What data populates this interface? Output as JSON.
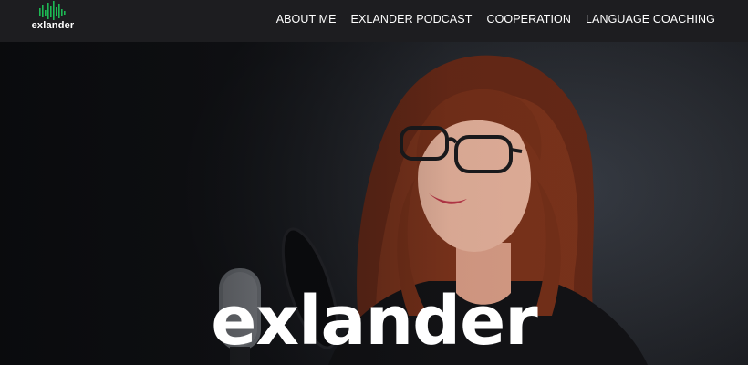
{
  "header": {
    "logo_text": "exlander",
    "nav": [
      {
        "label": "ABOUT ME"
      },
      {
        "label": "EXLANDER PODCAST"
      },
      {
        "label": "COOPERATION"
      },
      {
        "label": "LANGUAGE COACHING"
      }
    ]
  },
  "hero": {
    "title": "exlander"
  },
  "colors": {
    "header_bg": "#1d1d20",
    "brand_green": "#1db954",
    "text": "#ffffff"
  },
  "icons": {
    "logo_mark": "soundwave-icon",
    "mic": "microphone-icon"
  }
}
